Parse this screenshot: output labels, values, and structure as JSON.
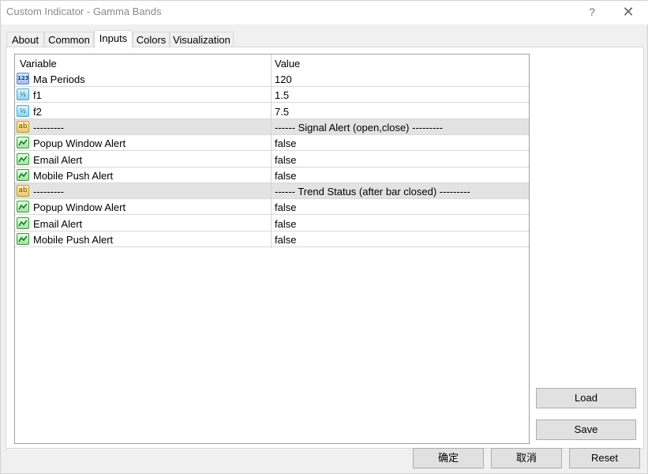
{
  "window": {
    "title": "Custom Indicator - Gamma Bands",
    "help_glyph": "?",
    "close_glyph": "✕"
  },
  "tabs": [
    {
      "label": "About"
    },
    {
      "label": "Common"
    },
    {
      "label": "Inputs",
      "active": true
    },
    {
      "label": "Colors"
    },
    {
      "label": "Visualization"
    }
  ],
  "grid": {
    "header": {
      "variable": "Variable",
      "value": "Value"
    },
    "rows": [
      {
        "icon": "int-icon",
        "icon_text": "123",
        "name": "Ma Periods",
        "value": "120",
        "separator": false
      },
      {
        "icon": "double-icon",
        "icon_text": "½",
        "name": "f1",
        "value": "1.5",
        "separator": false
      },
      {
        "icon": "double-icon",
        "icon_text": "½",
        "name": "f2",
        "value": "7.5",
        "separator": false
      },
      {
        "icon": "string-icon",
        "icon_text": "ab",
        "name": "---------",
        "value": "------ Signal Alert (open,close) ---------",
        "separator": true
      },
      {
        "icon": "bool-icon",
        "name": "Popup Window Alert",
        "value": "false",
        "separator": false
      },
      {
        "icon": "bool-icon",
        "name": "Email Alert",
        "value": "false",
        "separator": false
      },
      {
        "icon": "bool-icon",
        "name": "Mobile Push Alert",
        "value": "false",
        "separator": false
      },
      {
        "icon": "string-icon",
        "icon_text": "ab",
        "name": "---------",
        "value": "------ Trend Status (after bar closed) ---------",
        "separator": true
      },
      {
        "icon": "bool-icon",
        "name": "Popup Window Alert",
        "value": "false",
        "separator": false
      },
      {
        "icon": "bool-icon",
        "name": "Email Alert",
        "value": "false",
        "separator": false
      },
      {
        "icon": "bool-icon",
        "name": "Mobile Push Alert",
        "value": "false",
        "separator": false
      }
    ]
  },
  "side_buttons": {
    "load": "Load",
    "save": "Save"
  },
  "footer_buttons": {
    "ok": "确定",
    "cancel": "取消",
    "reset": "Reset"
  }
}
